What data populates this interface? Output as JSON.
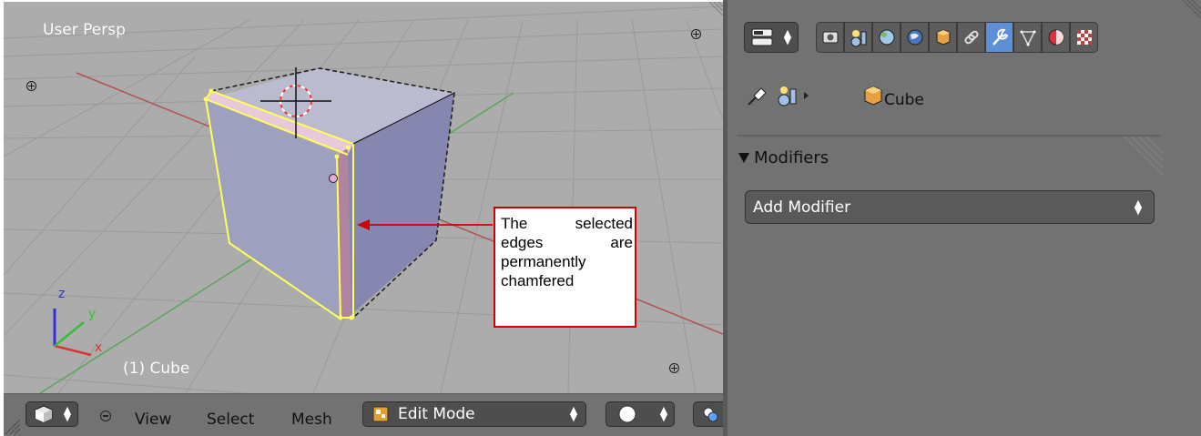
{
  "viewport": {
    "view_name": "User Persp",
    "object_info": "(1) Cube",
    "annotation": "The selected edges are permanently chamfered",
    "axis_labels": {
      "x": "x",
      "y": "y",
      "z": "z"
    }
  },
  "viewport_header": {
    "menus": [
      "View",
      "Select",
      "Mesh"
    ],
    "mode_label": "Edit Mode"
  },
  "properties": {
    "context_tabs": [
      "render",
      "render-layers",
      "scene",
      "world",
      "object",
      "constraints",
      "modifiers",
      "data",
      "material",
      "texture"
    ],
    "active_tab": "modifiers",
    "breadcrumb": {
      "object_name": "Cube"
    },
    "panel": {
      "title": "Modifiers",
      "collapsed": false
    },
    "add_modifier_label": "Add Modifier"
  },
  "colors": {
    "viewport_bg": "#acacac",
    "selection": "#ffff66",
    "chamfer_face": "#c090b0",
    "active_tab": "#5e8ed6",
    "callout_border": "#d20000"
  }
}
